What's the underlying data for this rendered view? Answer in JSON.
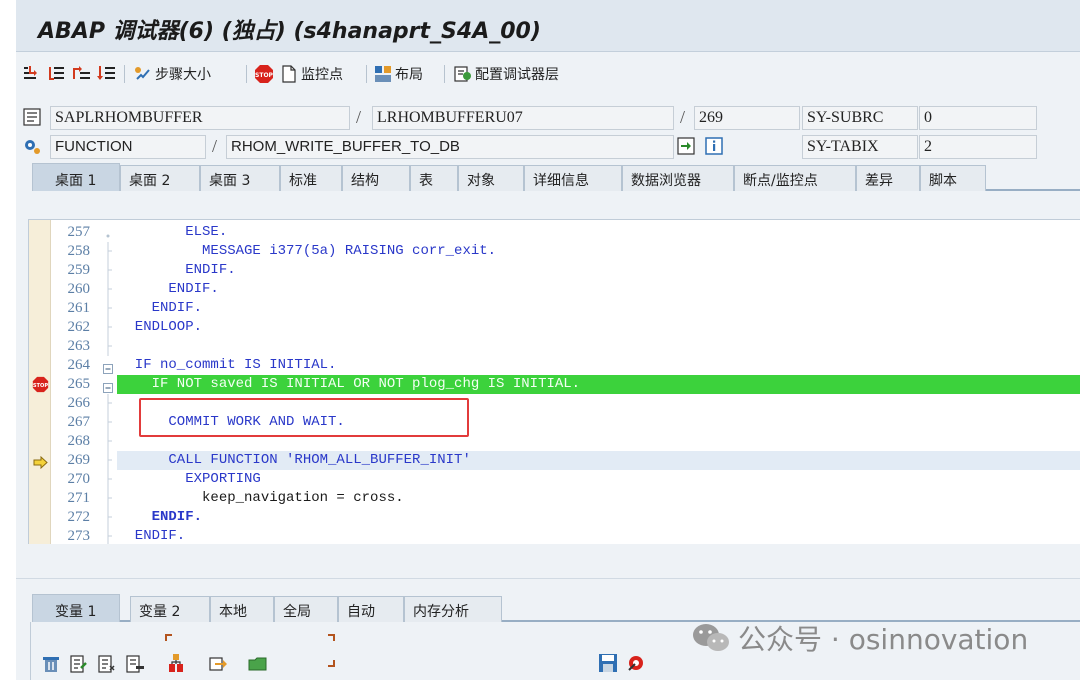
{
  "window": {
    "title": "ABAP 调试器(6) (独占) (s4hanaprt_S4A_00)"
  },
  "toolbar": {
    "step_size_label": "步骤大小",
    "watchpoint_label": "监控点",
    "layout_label": "布局",
    "config_label": "配置调试器层"
  },
  "header": {
    "program": "SAPLRHOMBUFFER",
    "include": "LRHOMBUFFERU07",
    "line_no": "269",
    "event_type": "FUNCTION",
    "event_name": "RHOM_WRITE_BUFFER_TO_DB",
    "sysvar1_name": "SY-SUBRC",
    "sysvar1_value": "0",
    "sysvar2_name": "SY-TABIX",
    "sysvar2_value": "2"
  },
  "tabs": [
    "桌面 1",
    "桌面 2",
    "桌面 3",
    "标准",
    "结构",
    "表",
    "对象",
    "详细信息",
    "数据浏览器",
    "断点/监控点",
    "差异",
    "脚本"
  ],
  "code_lines": [
    {
      "n": "257",
      "text": "        ELSE."
    },
    {
      "n": "258",
      "text": "          MESSAGE i377(5a) RAISING corr_exit."
    },
    {
      "n": "259",
      "text": "        ENDIF."
    },
    {
      "n": "260",
      "text": "      ENDIF."
    },
    {
      "n": "261",
      "text": "    ENDIF."
    },
    {
      "n": "262",
      "text": "  ENDLOOP."
    },
    {
      "n": "263",
      "text": ""
    },
    {
      "n": "264",
      "text": "  IF no_commit IS INITIAL."
    },
    {
      "n": "265",
      "text": "    IF NOT saved IS INITIAL OR NOT plog_chg IS INITIAL."
    },
    {
      "n": "266",
      "text": ""
    },
    {
      "n": "267",
      "text": "      COMMIT WORK AND WAIT."
    },
    {
      "n": "268",
      "text": ""
    },
    {
      "n": "269",
      "text": "      CALL FUNCTION 'RHOM_ALL_BUFFER_INIT'"
    },
    {
      "n": "270",
      "text": "        EXPORTING"
    },
    {
      "n": "271",
      "text": "          keep_navigation = cross."
    },
    {
      "n": "272",
      "text": "    ENDIF."
    },
    {
      "n": "273",
      "text": "  ENDIF."
    }
  ],
  "var_tabs": [
    "变量 1",
    "变量 2",
    "本地",
    "全局",
    "自动",
    "内存分析"
  ],
  "watermark": "公众号 · osinnovation",
  "colors": {
    "current_line": "#3cd23c",
    "next_line": "#e2ebf5",
    "highlight_box": "#e23b3b"
  }
}
